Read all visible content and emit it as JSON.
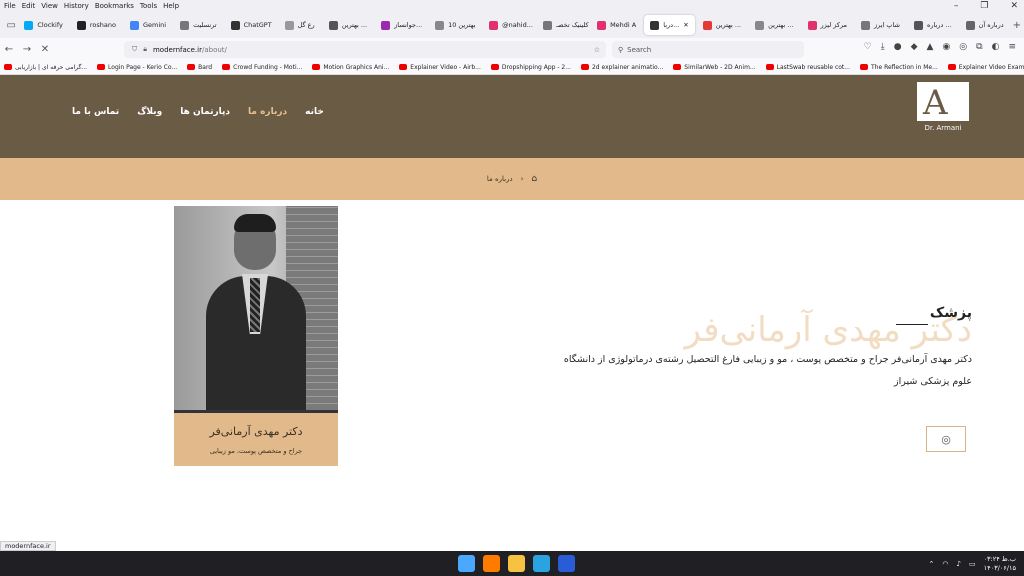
{
  "browser": {
    "menu": [
      "File",
      "Edit",
      "View",
      "History",
      "Bookmarks",
      "Tools",
      "Help"
    ],
    "tabs": [
      {
        "label": "Clockify",
        "color": "#03a9f4"
      },
      {
        "label": "roshano",
        "color": "#222222"
      },
      {
        "label": "Gemini",
        "color": "#4285f4"
      },
      {
        "label": "ترنسلیت",
        "color": "#777777"
      },
      {
        "label": "ChatGPT",
        "color": "#333333"
      },
      {
        "label": "رع گل",
        "color": "#999999"
      },
      {
        "label": "بهترین ...",
        "color": "#555555"
      },
      {
        "label": "جوانساز...",
        "color": "#9c27b0"
      },
      {
        "label": "10 بهترین",
        "color": "#888888"
      },
      {
        "label": "@nahid...",
        "color": "#e1306c"
      },
      {
        "label": "کلینیک تخصـ",
        "color": "#777777"
      },
      {
        "label": "Mehdi A",
        "color": "#e1306c"
      },
      {
        "label": "دربا...",
        "color": "#333333"
      },
      {
        "label": "بهترین ...",
        "color": "#e53935"
      },
      {
        "label": "بهترین ...",
        "color": "#888888"
      },
      {
        "label": "مرکز لیزر",
        "color": "#e1306c"
      },
      {
        "label": "شاپ ایرز",
        "color": "#777777"
      },
      {
        "label": "درباره ...",
        "color": "#555555"
      },
      {
        "label": "درباره آن",
        "color": "#666666"
      }
    ],
    "active_tab_index": 12,
    "url_host": "modernface.ir",
    "url_path": "/about/",
    "search_placeholder": "Search",
    "bookmarks": [
      "گرامی حرفه ای | بازاریابی...",
      "Login Page - Kerio Co...",
      "Bard",
      "Crowd Funding - Moti...",
      "Motion Graphics Ani...",
      "Explainer Video - Airb...",
      "Dropshipping App - 2...",
      "2d explainer animatio...",
      "SimilarWeb - 2D Anim...",
      "LastSwab reusable cot...",
      "The Reflection in Me...",
      "Explainer Video Exam..."
    ],
    "status_url": "modernface.ir"
  },
  "site": {
    "brand_color": "#6a5b45",
    "accent_color": "#e2b98a",
    "logo_text": "Dr. Armani",
    "logo_mark": "A",
    "nav": [
      {
        "label": "خانه",
        "active": false
      },
      {
        "label": "درباره ما",
        "active": true
      },
      {
        "label": "دپارتمان ها",
        "active": false
      },
      {
        "label": "وبلاگ",
        "active": false
      },
      {
        "label": "تماس با ما",
        "active": false
      }
    ],
    "breadcrumb": {
      "home_icon": "home-icon",
      "separator": "›",
      "current": "درباره ما"
    },
    "card": {
      "name": "دکتر مهدی آرمانی‌فر",
      "role": "جراح و متخصص پوست، مو زیبایی"
    },
    "bio": {
      "ghost_title": "دکتر مهدی آرمانی‌فر",
      "title": "پزشک",
      "text": "دکتر مهدی آرمانی‌فر جراح و متخصص پوست ، مو و زیبایی فارغ التحصیل رشته‌ی درماتولوژی از دانشگاه علوم پزشکی شیراز"
    },
    "instagram_icon": "instagram-icon"
  },
  "taskbar": {
    "time": "۰۳:۲۴ ب.ظ",
    "date": "۱۴۰۳/۰۶/۱۵",
    "apps": [
      {
        "name": "start",
        "color": "#4aa8ff"
      },
      {
        "name": "firefox",
        "color": "#ff7b00"
      },
      {
        "name": "file-explorer",
        "color": "#f5c242"
      },
      {
        "name": "telegram",
        "color": "#2aa3e0"
      },
      {
        "name": "word",
        "color": "#2b5cd8"
      }
    ]
  }
}
